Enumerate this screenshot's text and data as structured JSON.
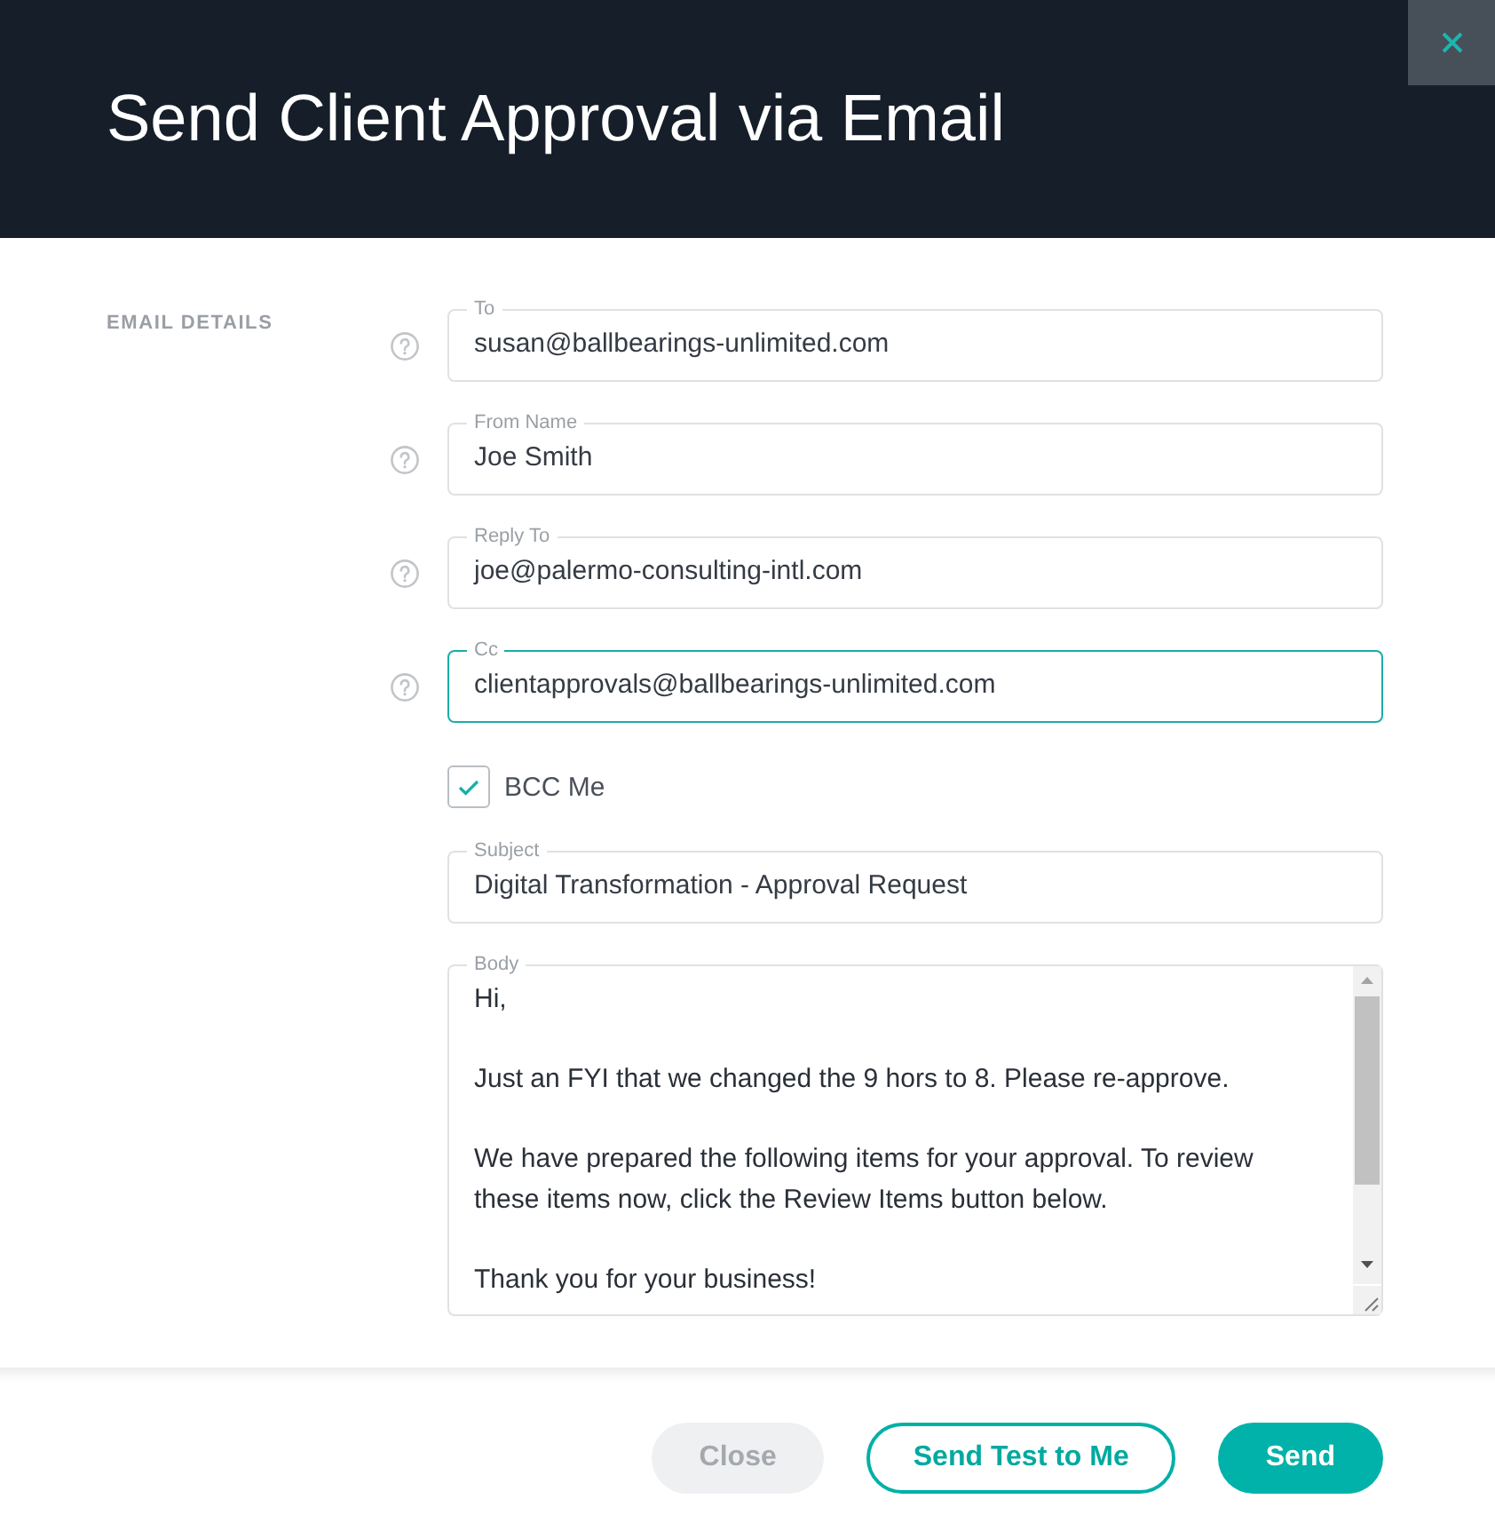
{
  "dialog": {
    "title": "Send Client Approval via Email"
  },
  "section_label": "EMAIL DETAILS",
  "fields": [
    {
      "label": "To",
      "value": "susan@ballbearings-unlimited.com",
      "help": true,
      "focused": false
    },
    {
      "label": "From Name",
      "value": "Joe Smith",
      "help": true,
      "focused": false
    },
    {
      "label": "Reply To",
      "value": "joe@palermo-consulting-intl.com",
      "help": true,
      "focused": false
    },
    {
      "label": "Cc",
      "value": "clientapprovals@ballbearings-unlimited.com",
      "help": true,
      "focused": true
    }
  ],
  "bcc_me": {
    "label": "BCC Me",
    "checked": true
  },
  "subject": {
    "label": "Subject",
    "value": "Digital Transformation - Approval Request"
  },
  "body": {
    "label": "Body",
    "paragraphs": [
      "Hi,",
      "Just an FYI that we changed the 9 hors to 8. Please re-approve.",
      "We have prepared the following items for your approval. To review these items now, click the Review Items button below.",
      "Thank you for your business!"
    ]
  },
  "buttons": [
    {
      "label": "Close",
      "kind": "secondary"
    },
    {
      "label": "Send Test to Me",
      "kind": "outline"
    },
    {
      "label": "Send",
      "kind": "primary"
    }
  ]
}
